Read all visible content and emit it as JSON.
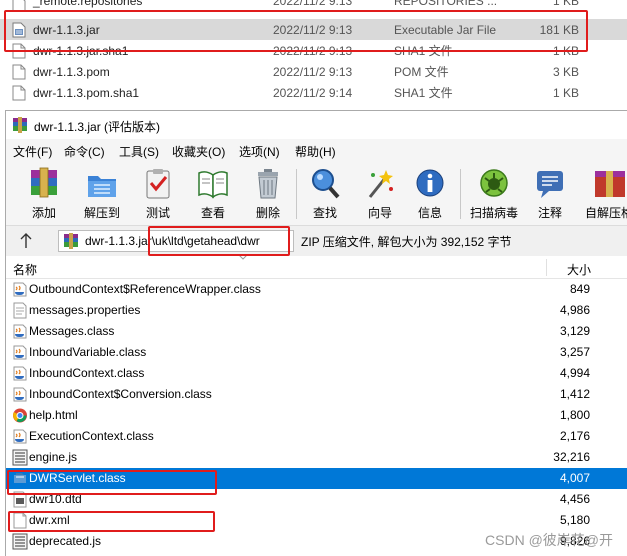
{
  "explorer": {
    "rows": [
      {
        "name": "_remote.repositories",
        "date": "2022/11/2 9:13",
        "type": "REPOSITORIES ...",
        "size": "1 KB"
      },
      {
        "name": "dwr-1.1.3.jar",
        "date": "2022/11/2 9:13",
        "type": "Executable Jar File",
        "size": "181 KB"
      },
      {
        "name": "dwr-1.1.3.jar.sha1",
        "date": "2022/11/2 9:13",
        "type": "SHA1 文件",
        "size": "1 KB"
      },
      {
        "name": "dwr-1.1.3.pom",
        "date": "2022/11/2 9:13",
        "type": "POM 文件",
        "size": "3 KB"
      },
      {
        "name": "dwr-1.1.3.pom.sha1",
        "date": "2022/11/2 9:14",
        "type": "SHA1 文件",
        "size": "1 KB"
      }
    ]
  },
  "window": {
    "title": "dwr-1.1.3.jar (评估版本)"
  },
  "menu": {
    "items": [
      "文件(F)",
      "命令(C)",
      "工具(S)",
      "收藏夹(O)",
      "选项(N)",
      "帮助(H)"
    ]
  },
  "toolbar": {
    "buttons": [
      {
        "label": "添加",
        "icon": "add-archive-icon"
      },
      {
        "label": "解压到",
        "icon": "extract-folder-icon"
      },
      {
        "label": "测试",
        "icon": "test-clipboard-icon"
      },
      {
        "label": "查看",
        "icon": "view-book-icon"
      },
      {
        "label": "删除",
        "icon": "trash-icon"
      },
      {
        "label": "查找",
        "icon": "find-magnifier-icon"
      },
      {
        "label": "向导",
        "icon": "wizard-wand-icon"
      },
      {
        "label": "信息",
        "icon": "info-icon"
      },
      {
        "label": "扫描病毒",
        "icon": "virus-scan-icon"
      },
      {
        "label": "注释",
        "icon": "comment-icon"
      },
      {
        "label": "自解压格",
        "icon": "sfx-box-icon"
      }
    ]
  },
  "address": {
    "path": "dwr-1.1.3.jar\\uk\\ltd\\getahead\\dwr",
    "info": "ZIP 压缩文件, 解包大小为 392,152 字节"
  },
  "list": {
    "header_name": "名称",
    "header_size": "大小",
    "rows": [
      {
        "name": "OutboundContext$ReferenceWrapper.class",
        "size": "849",
        "icon": "java-class-icon"
      },
      {
        "name": "messages.properties",
        "size": "4,986",
        "icon": "text-file-icon"
      },
      {
        "name": "Messages.class",
        "size": "3,129",
        "icon": "java-class-icon"
      },
      {
        "name": "InboundVariable.class",
        "size": "3,257",
        "icon": "java-class-icon"
      },
      {
        "name": "InboundContext.class",
        "size": "4,994",
        "icon": "java-class-icon"
      },
      {
        "name": "InboundContext$Conversion.class",
        "size": "1,412",
        "icon": "java-class-icon"
      },
      {
        "name": "help.html",
        "size": "1,800",
        "icon": "chrome-html-icon"
      },
      {
        "name": "ExecutionContext.class",
        "size": "2,176",
        "icon": "java-class-icon"
      },
      {
        "name": "engine.js",
        "size": "32,216",
        "icon": "js-file-icon"
      },
      {
        "name": "DWRServlet.class",
        "size": "4,007",
        "icon": "java-class-icon",
        "selected": true
      },
      {
        "name": "dwr10.dtd",
        "size": "4,456",
        "icon": "dtd-file-icon"
      },
      {
        "name": "dwr.xml",
        "size": "5,180",
        "icon": "blank-file-icon"
      },
      {
        "name": "deprecated.js",
        "size": "9,826",
        "icon": "js-file-icon"
      }
    ]
  },
  "watermark": "CSDN @彼岸花@开",
  "colors": {
    "selection": "#0078d7",
    "annotation": "#e01c1c"
  }
}
